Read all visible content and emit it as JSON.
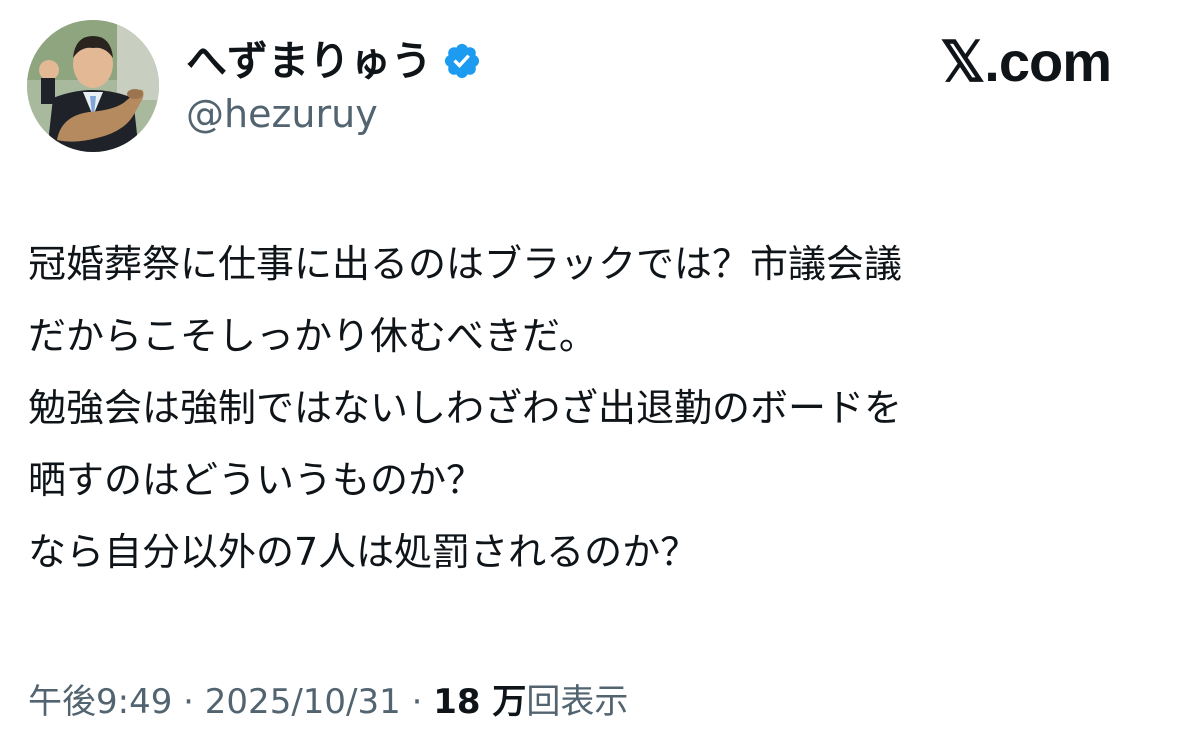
{
  "header": {
    "display_name": "へずまりゅう",
    "handle": "@hezuruy",
    "verified_icon": "verified-badge-icon",
    "verified_color": "#1d9bf0",
    "site_mark": "𝕏.com"
  },
  "tweet": {
    "lines": [
      "冠婚葬祭に仕事に出るのはブラックでは？市議会議",
      "だからこそしっかり休むべきだ。",
      "勉強会は強制ではないしわざわざ出退勤のボードを",
      "晒すのはどういうものか？",
      "なら自分以外の7人は処罰されるのか？"
    ]
  },
  "meta": {
    "time": "午後9:49",
    "separator": " · ",
    "date": "2025/10/31",
    "views_count": "18 万",
    "views_label": "回表示"
  }
}
